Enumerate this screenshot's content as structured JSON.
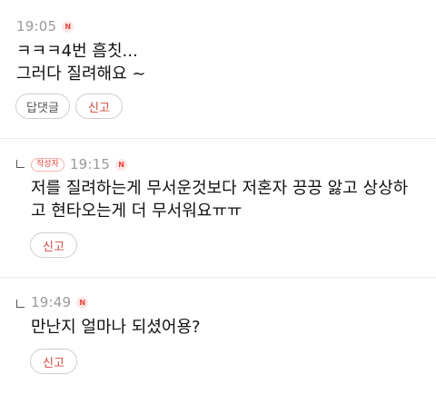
{
  "comments": [
    {
      "time": "19:05",
      "badge": "N",
      "text": "ㅋㅋㅋ4번 흠칫...\n그러다 질려해요 ~",
      "reply_label": "답댓글",
      "report_label": "신고"
    },
    {
      "author_badge": "작성자",
      "time": "19:15",
      "badge": "N",
      "text": "저를 질려하는게 무서운것보다 저혼자 끙끙 앓고 상상하\n고 현타오는게 더 무서워요ㅠㅠ",
      "report_label": "신고"
    },
    {
      "time": "19:49",
      "badge": "N",
      "text": "만난지 얼마나 되셨어용?",
      "report_label": "신고"
    }
  ]
}
